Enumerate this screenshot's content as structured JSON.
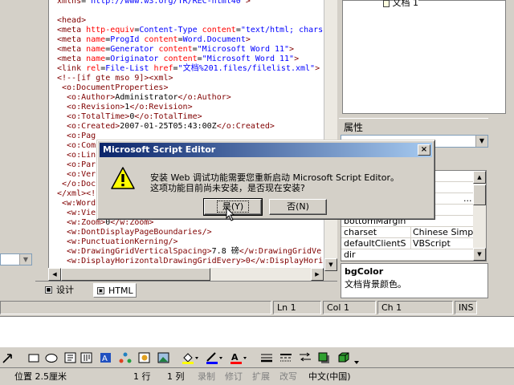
{
  "editor": {
    "lines": [
      [
        {
          "c": "tag",
          "t": "xmlns"
        },
        {
          "c": "txt",
          "t": "="
        },
        {
          "c": "val",
          "t": "\"http://www.w3.org/TR/REC-html40\""
        },
        {
          "c": "tag",
          "t": ">"
        }
      ],
      [
        {
          "c": "txt",
          "t": ""
        }
      ],
      [
        {
          "c": "tag",
          "t": "<head>"
        }
      ],
      [
        {
          "c": "tag",
          "t": "<meta "
        },
        {
          "c": "attr",
          "t": "http-equiv"
        },
        {
          "c": "txt",
          "t": "="
        },
        {
          "c": "val",
          "t": "Content-Type "
        },
        {
          "c": "attr",
          "t": "content"
        },
        {
          "c": "txt",
          "t": "="
        },
        {
          "c": "val",
          "t": "\"text/html; chars"
        }
      ],
      [
        {
          "c": "tag",
          "t": "<meta "
        },
        {
          "c": "attr",
          "t": "name"
        },
        {
          "c": "txt",
          "t": "="
        },
        {
          "c": "val",
          "t": "ProgId "
        },
        {
          "c": "attr",
          "t": "content"
        },
        {
          "c": "txt",
          "t": "="
        },
        {
          "c": "val",
          "t": "Word.Document"
        },
        {
          "c": "tag",
          "t": ">"
        }
      ],
      [
        {
          "c": "tag",
          "t": "<meta "
        },
        {
          "c": "attr",
          "t": "name"
        },
        {
          "c": "txt",
          "t": "="
        },
        {
          "c": "val",
          "t": "Generator "
        },
        {
          "c": "attr",
          "t": "content"
        },
        {
          "c": "txt",
          "t": "="
        },
        {
          "c": "val",
          "t": "\"Microsoft Word 11\""
        },
        {
          "c": "tag",
          "t": ">"
        }
      ],
      [
        {
          "c": "tag",
          "t": "<meta "
        },
        {
          "c": "attr",
          "t": "name"
        },
        {
          "c": "txt",
          "t": "="
        },
        {
          "c": "val",
          "t": "Originator "
        },
        {
          "c": "attr",
          "t": "content"
        },
        {
          "c": "txt",
          "t": "="
        },
        {
          "c": "val",
          "t": "\"Microsoft Word 11\""
        },
        {
          "c": "tag",
          "t": ">"
        }
      ],
      [
        {
          "c": "tag",
          "t": "<link "
        },
        {
          "c": "attr",
          "t": "rel"
        },
        {
          "c": "txt",
          "t": "="
        },
        {
          "c": "val",
          "t": "File-List "
        },
        {
          "c": "attr",
          "t": "href"
        },
        {
          "c": "txt",
          "t": "="
        },
        {
          "c": "val",
          "t": "\"文档%201.files/filelist.xml\""
        },
        {
          "c": "tag",
          "t": ">"
        }
      ],
      [
        {
          "c": "tag",
          "t": "<!--[if gte mso 9]><xml>"
        }
      ],
      [
        {
          "c": "tag",
          "t": " <o:DocumentProperties>"
        }
      ],
      [
        {
          "c": "tag",
          "t": "  <o:Author>"
        },
        {
          "c": "txt",
          "t": "Administrator"
        },
        {
          "c": "tag",
          "t": "</o:Author>"
        }
      ],
      [
        {
          "c": "tag",
          "t": "  <o:Revision>"
        },
        {
          "c": "txt",
          "t": "1"
        },
        {
          "c": "tag",
          "t": "</o:Revision>"
        }
      ],
      [
        {
          "c": "tag",
          "t": "  <o:TotalTime>"
        },
        {
          "c": "txt",
          "t": "0"
        },
        {
          "c": "tag",
          "t": "</o:TotalTime>"
        }
      ],
      [
        {
          "c": "tag",
          "t": "  <o:Created>"
        },
        {
          "c": "txt",
          "t": "2007-01-25T05:43:00Z"
        },
        {
          "c": "tag",
          "t": "</o:Created>"
        }
      ],
      [
        {
          "c": "tag",
          "t": "  <o:Pag"
        }
      ],
      [
        {
          "c": "tag",
          "t": "  <o:Com"
        }
      ],
      [
        {
          "c": "tag",
          "t": "  <o:Lin"
        }
      ],
      [
        {
          "c": "tag",
          "t": "  <o:Par"
        }
      ],
      [
        {
          "c": "tag",
          "t": "  <o:Ver"
        }
      ],
      [
        {
          "c": "tag",
          "t": " </o:Doc"
        }
      ],
      [
        {
          "c": "tag",
          "t": "</xml><!"
        }
      ],
      [
        {
          "c": "tag",
          "t": " <w:Word"
        }
      ],
      [
        {
          "c": "tag",
          "t": "  <w:Vie"
        }
      ],
      [
        {
          "c": "tag",
          "t": "  <w:Zoom>"
        },
        {
          "c": "txt",
          "t": "0"
        },
        {
          "c": "tag",
          "t": "</w:Zoom>"
        }
      ],
      [
        {
          "c": "tag",
          "t": "  <w:DontDisplayPageBoundaries/>"
        }
      ],
      [
        {
          "c": "tag",
          "t": "  <w:PunctuationKerning/>"
        }
      ],
      [
        {
          "c": "tag",
          "t": "  <w:DrawingGridVerticalSpacing>"
        },
        {
          "c": "txt",
          "t": "7.8 磅"
        },
        {
          "c": "tag",
          "t": "</w:DrawingGridVe"
        }
      ],
      [
        {
          "c": "tag",
          "t": "  <w:DisplayHorizontalDrawingGridEvery>0</w:DisplayHori"
        }
      ]
    ]
  },
  "tabs": {
    "design": "设计",
    "html": "HTML"
  },
  "outline": {
    "node": "文档 1"
  },
  "properties": {
    "title": "属性",
    "title_buttons": "▾ ✕",
    "rows": [
      {
        "name": "bottomMargin",
        "value": ""
      },
      {
        "name": "charset",
        "value": "Chinese Simpl"
      },
      {
        "name": "defaultClientS",
        "value": "VBScript"
      },
      {
        "name": "dir",
        "value": ""
      }
    ],
    "desc_name": "bgColor",
    "desc_text": "文档背景颜色。"
  },
  "status": {
    "ln": "Ln 1",
    "col": "Col 1",
    "ch": "Ch 1",
    "ins": "INS"
  },
  "word_status": {
    "position": "位置 2.5厘米",
    "row": "1 行",
    "col": "1 列",
    "rec": "录制",
    "trk": "修订",
    "ext": "扩展",
    "ovr": "改写",
    "lang": "中文(中国)"
  },
  "dialog": {
    "title": "Microsoft Script Editor",
    "message_line1": "安装 Web 调试功能需要您重新启动 Microsoft Script Editor。",
    "message_line2": "这项功能目前尚未安装，是否现在安装?",
    "yes": "是(Y)",
    "no": "否(N)",
    "close": "×"
  }
}
